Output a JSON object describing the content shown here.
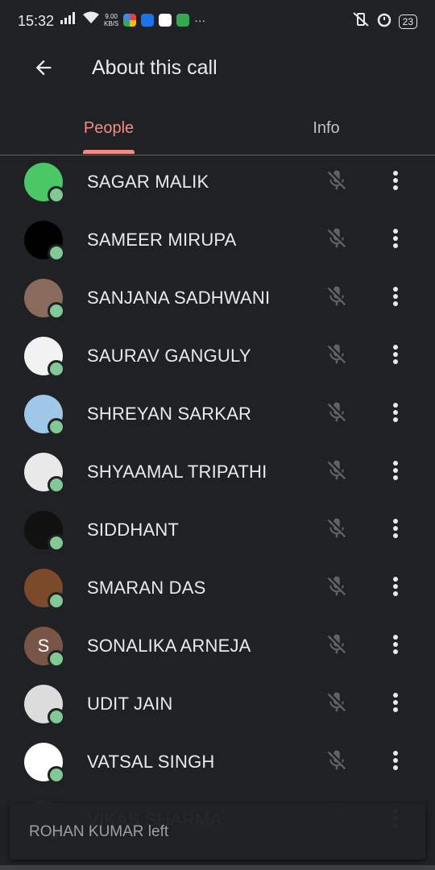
{
  "status_bar": {
    "time": "15:32",
    "net_speed_value": "9.00",
    "net_speed_unit": "KB/S",
    "battery": "23"
  },
  "header": {
    "title": "About this call"
  },
  "tabs": [
    {
      "label": "People",
      "active": true
    },
    {
      "label": "Info",
      "active": false
    }
  ],
  "participants": [
    {
      "name": "SAGAR MALIK",
      "avatar_color": "#4cc765",
      "avatar_letter": ""
    },
    {
      "name": "SAMEER MIRUPA",
      "avatar_color": "#000000",
      "avatar_letter": ""
    },
    {
      "name": "SANJANA SADHWANI",
      "avatar_color": "#8a6a5c",
      "avatar_letter": ""
    },
    {
      "name": "SAURAV GANGULY",
      "avatar_color": "#f2f2f2",
      "avatar_letter": ""
    },
    {
      "name": "SHREYAN SARKAR",
      "avatar_color": "#9ec7e8",
      "avatar_letter": ""
    },
    {
      "name": "SHYAAMAL TRIPATHI",
      "avatar_color": "#e9e9e9",
      "avatar_letter": ""
    },
    {
      "name": "SIDDHANT",
      "avatar_color": "#111111",
      "avatar_letter": ""
    },
    {
      "name": "SMARAN DAS",
      "avatar_color": "#7a4a2a",
      "avatar_letter": ""
    },
    {
      "name": "SONALIKA ARNEJA",
      "avatar_color": "#795548",
      "avatar_letter": "S"
    },
    {
      "name": "UDIT JAIN",
      "avatar_color": "#dcdcdc",
      "avatar_letter": ""
    },
    {
      "name": "VATSAL SINGH",
      "avatar_color": "#ffffff",
      "avatar_letter": ""
    },
    {
      "name": "VIKAS SHARMA",
      "avatar_color": "#2a3a4a",
      "avatar_letter": ""
    }
  ],
  "snackbar": {
    "message": "ROHAN KUMAR left"
  },
  "colors": {
    "background": "#202124",
    "accent": "#f28b82",
    "presence": "#81c995"
  }
}
